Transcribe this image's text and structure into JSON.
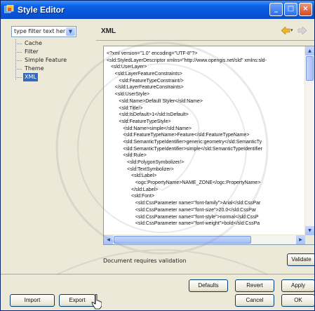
{
  "window": {
    "title": "Style Editor"
  },
  "filter": {
    "value": "type filter text her"
  },
  "nav": {
    "items": [
      {
        "label": "Cache",
        "selected": false
      },
      {
        "label": "Filter",
        "selected": false
      },
      {
        "label": "Simple Feature",
        "selected": false
      },
      {
        "label": "Theme",
        "selected": false
      },
      {
        "label": "XML",
        "selected": true
      }
    ]
  },
  "panel": {
    "title": "XML"
  },
  "xml": {
    "lines": [
      "<?xml version=\"1.0\" encoding=\"UTF-8\"?>",
      "<sld:StyledLayerDescriptor xmlns=\"http://www.opengis.net/sld\" xmlns:sld-",
      "   <sld:UserLayer>",
      "      <sld:LayerFeatureConstraints>",
      "         <sld:FeatureTypeConstraint/>",
      "      </sld:LayerFeatureConstraints>",
      "      <sld:UserStyle>",
      "         <sld:Name>Default Styler</sld:Name>",
      "         <sld:Title/>",
      "         <sld:IsDefault>1</sld:IsDefault>",
      "         <sld:FeatureTypeStyle>",
      "            <sld:Name>simple</sld:Name>",
      "            <sld:FeatureTypeName>Feature</sld:FeatureTypeName>",
      "            <sld:SemanticTypeIdentifier>generic:geometry</sld:SemanticTy",
      "            <sld:SemanticTypeIdentifier>simple</sld:SemanticTypeIdentifier",
      "            <sld:Rule>",
      "               <sld:PolygonSymbolizer/>",
      "               <sld:TextSymbolizer>",
      "                  <sld:Label>",
      "                     <ogc:PropertyName>NAME_ZONE</ogc:PropertyName>",
      "                  </sld:Label>",
      "                  <sld:Font>",
      "                     <sld:CssParameter name=\"font-family\">Arial</sld:CssPar",
      "                     <sld:CssParameter name=\"font-size\">20.0</sld:CssPar",
      "                     <sld:CssParameter name=\"font-style\">normal</sld:CssP",
      "                     <sld:CssParameter name=\"font-weight\">bold</sld:CssPa"
    ]
  },
  "status": {
    "text": "Document requires validation"
  },
  "buttons": {
    "validate": "Validate",
    "defaults": "Defaults",
    "revert": "Revert",
    "apply": "Apply",
    "import": "Import",
    "export": "Export",
    "cancel": "Cancel",
    "ok": "OK"
  },
  "icons": {
    "app": "style-editor-icon",
    "dropdown": "chevron-down-icon",
    "back": "back-arrow-icon",
    "forward": "forward-arrow-icon",
    "history_menu": "history-menu-icon",
    "minimize": "minimize-icon",
    "maximize": "maximize-icon",
    "close": "close-icon",
    "cursor": "mouse-pointer-icon"
  },
  "colors": {
    "title_bar": "#0755d8",
    "window_bg": "#ece9d8",
    "selection": "#316ac5",
    "button_border": "#003c74"
  }
}
